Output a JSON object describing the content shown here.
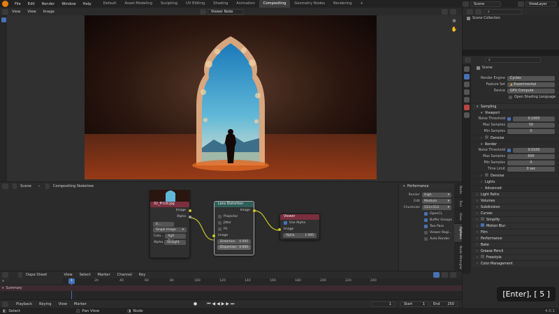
{
  "topbar": {
    "menus": [
      "File",
      "Edit",
      "Render",
      "Window",
      "Help"
    ],
    "workspaces": [
      "Default",
      "Asset Modeling",
      "Sculpting",
      "UV Editing",
      "Shading",
      "Animation",
      "Compositing",
      "Geometry Nodes",
      "Rendering"
    ],
    "active_workspace": "Compositing",
    "scene": "Scene",
    "view_layer": "ViewLayer"
  },
  "viewer_header": {
    "view": "View",
    "view2": "View",
    "image": "Image",
    "image_name": "Viewer Node"
  },
  "node_header": {
    "scene": "Scene",
    "tree": "Compositing Nodetree"
  },
  "nodes": {
    "image_node": {
      "title": "02_Pr1ld.jpg",
      "out_image": "Image",
      "out_alpha": "Alpha",
      "frame_field": "0...",
      "source": "Single Image",
      "color_label": "Colo...",
      "color_value": "AgX Bas...",
      "alpha_label": "Alpha",
      "alpha_value": "Straight"
    },
    "lens": {
      "title": "Lens Distortion",
      "out_image": "Image",
      "projector": "Projector",
      "jitter": "Jitter",
      "fit": "Fit",
      "in_image": "Image",
      "distortion_label": "Distortion",
      "distortion_value": "0.000",
      "dispersion_label": "Dispersion",
      "dispersion_value": "0.900"
    },
    "viewer": {
      "title": "Viewer",
      "use_alpha": "Use Alpha",
      "image": "Image",
      "alpha_label": "Alpha",
      "alpha_value": "1.000"
    }
  },
  "n_panel": {
    "title": "Performance",
    "render_label": "Render",
    "render_value": "High",
    "edit_label": "Edit",
    "edit_value": "Medium",
    "chunksize_label": "Chunksize",
    "chunksize_value": "512×512",
    "opencl": "OpenCL",
    "buffer_groups": "Buffer Groups",
    "two_pass": "Two Pass",
    "viewer_region": "Viewer Regi...",
    "auto_render": "Auto Render",
    "tabs": [
      "Node",
      "Tool",
      "View",
      "Options",
      "Node Wrangler"
    ]
  },
  "outliner": {
    "title": "Scene Collection"
  },
  "properties": {
    "scene": "Scene",
    "render_engine_label": "Render Engine",
    "render_engine": "Cycles",
    "feature_set_label": "Feature Set",
    "feature_set": "Experimental",
    "device_label": "Device",
    "device": "GPU Compute",
    "osl": "Open Shading Language",
    "sampling": "Sampling",
    "viewport": "Viewport",
    "vp_noise_label": "Noise Threshold",
    "vp_noise": "0.1000",
    "vp_max_label": "Max Samples",
    "vp_max": "50",
    "vp_min_label": "Min Samples",
    "vp_min": "0",
    "denoise": "Denoise",
    "render": "Render",
    "r_noise_label": "Noise Threshold",
    "r_noise": "0.0100",
    "r_max_label": "Max Samples",
    "r_max": "600",
    "r_min_label": "Min Samples",
    "r_min": "0",
    "time_limit_label": "Time Limit",
    "time_limit": "0 sec",
    "denoise2": "Denoise",
    "lights": "Lights",
    "advanced": "Advanced",
    "panels": [
      "Light Paths",
      "Volumes",
      "Subdivision",
      "Curves",
      "Simplify",
      "Motion Blur",
      "Film",
      "Performance",
      "Bake",
      "Grease Pencil",
      "Freestyle",
      "Color Management"
    ]
  },
  "dope": {
    "mode": "Dope Sheet",
    "menus": [
      "View",
      "Select",
      "Marker",
      "Channel",
      "Key"
    ],
    "summary": "Summary",
    "current_frame": "1",
    "frames": [
      "20",
      "40",
      "60",
      "80",
      "100",
      "120",
      "140",
      "160",
      "180",
      "200",
      "220",
      "240"
    ]
  },
  "timeline": {
    "menus": [
      "Playback",
      "Keying",
      "View",
      "Marker"
    ],
    "frame": "1",
    "start_label": "Start",
    "start": "1",
    "end_label": "End",
    "end": "250"
  },
  "status": {
    "select": "Select",
    "pan": "Pan View",
    "node": "Node",
    "version": "4.0.1"
  },
  "key_overlay": "[Enter], [ 5 ]"
}
